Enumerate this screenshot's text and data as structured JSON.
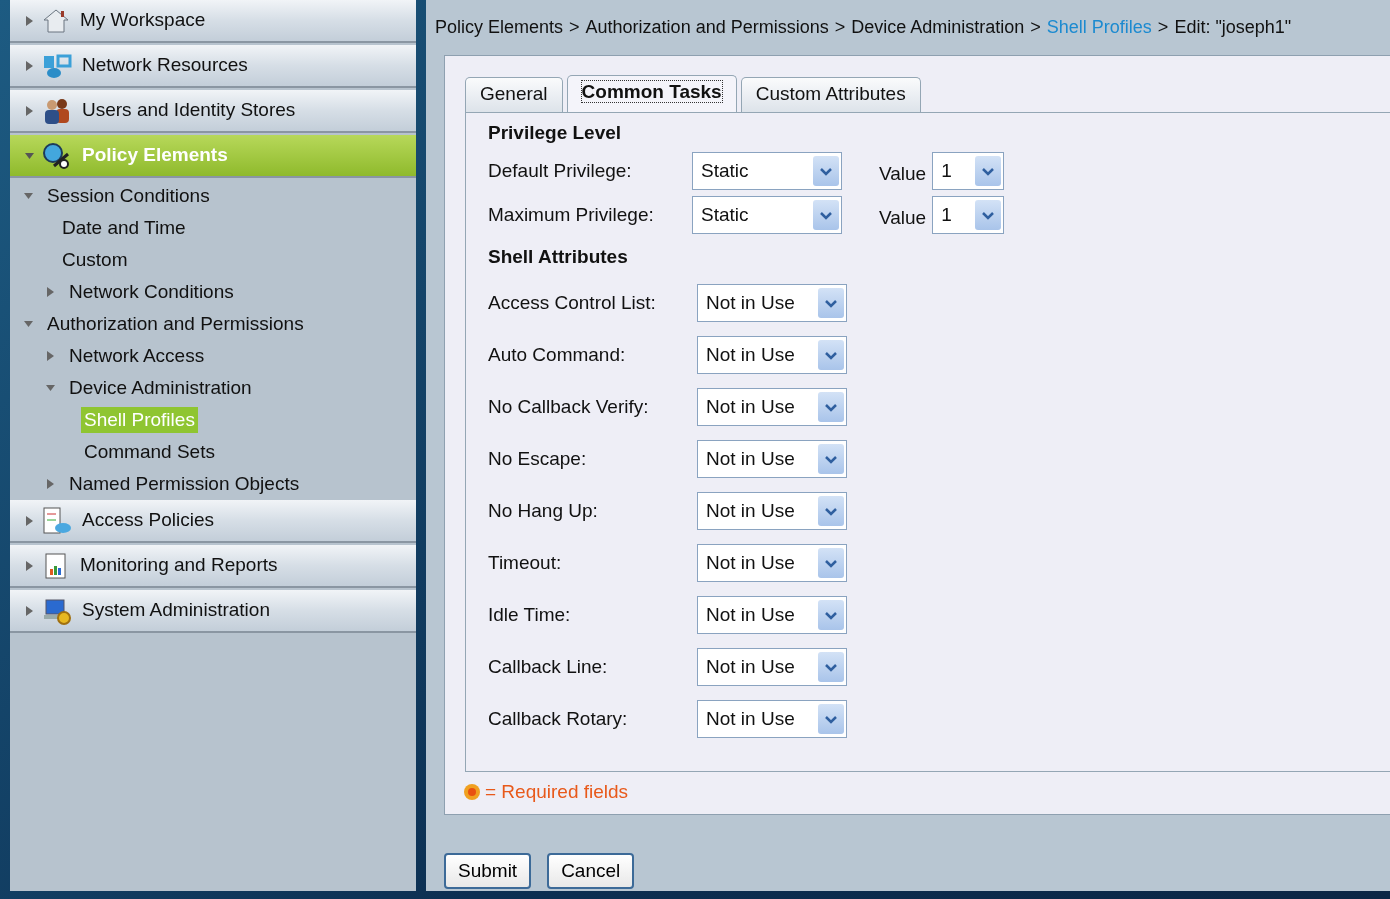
{
  "sidebar": {
    "items": [
      {
        "label": "My Workspace",
        "expanded": false,
        "selected": false
      },
      {
        "label": "Network Resources",
        "expanded": false,
        "selected": false
      },
      {
        "label": "Users and Identity Stores",
        "expanded": false,
        "selected": false
      },
      {
        "label": "Policy Elements",
        "expanded": true,
        "selected": true,
        "children": [
          {
            "label": "Session Conditions",
            "expanded": true,
            "selected": false,
            "children": [
              {
                "label": "Date and Time",
                "selected": false
              },
              {
                "label": "Custom",
                "selected": false
              },
              {
                "label": "Network Conditions",
                "expanded": false,
                "selected": false
              }
            ]
          },
          {
            "label": "Authorization and Permissions",
            "expanded": true,
            "selected": false,
            "children": [
              {
                "label": "Network Access",
                "expanded": false,
                "selected": false
              },
              {
                "label": "Device Administration",
                "expanded": true,
                "selected": false,
                "children": [
                  {
                    "label": "Shell Profiles",
                    "selected": true
                  },
                  {
                    "label": "Command Sets",
                    "selected": false
                  }
                ]
              },
              {
                "label": "Named Permission Objects",
                "expanded": false,
                "selected": false
              }
            ]
          }
        ]
      },
      {
        "label": "Access Policies",
        "expanded": false,
        "selected": false
      },
      {
        "label": "Monitoring and Reports",
        "expanded": false,
        "selected": false
      },
      {
        "label": "System Administration",
        "expanded": false,
        "selected": false
      }
    ]
  },
  "breadcrumb": [
    {
      "kind": "text",
      "text": "Policy Elements"
    },
    {
      "kind": "separator",
      "text": ">"
    },
    {
      "kind": "text",
      "text": "Authorization and Permissions"
    },
    {
      "kind": "separator",
      "text": ">"
    },
    {
      "kind": "text",
      "text": "Device Administration"
    },
    {
      "kind": "separator",
      "text": ">"
    },
    {
      "kind": "link",
      "text": "Shell Profiles"
    },
    {
      "kind": "separator",
      "text": ">"
    },
    {
      "kind": "text",
      "text": "Edit: \"joseph1\""
    }
  ],
  "tabs": [
    {
      "label": "General",
      "selected": false
    },
    {
      "label": "Common Tasks",
      "selected": true
    },
    {
      "label": "Custom Attributes",
      "selected": false
    }
  ],
  "sections": [
    {
      "title": "Privilege Level",
      "rows": [
        {
          "label": "Default Privilege:",
          "value": "Static",
          "extra": {
            "label": "Value",
            "value": "1"
          }
        },
        {
          "label": "Maximum Privilege:",
          "value": "Static",
          "extra": {
            "label": "Value",
            "value": "1"
          }
        }
      ]
    },
    {
      "title": "Shell Attributes",
      "rows": [
        {
          "label": "Access Control List:",
          "value": "Not in Use"
        },
        {
          "label": "Auto Command:",
          "value": "Not in Use"
        },
        {
          "label": "No Callback Verify:",
          "value": "Not in Use"
        },
        {
          "label": "No Escape:",
          "value": "Not in Use"
        },
        {
          "label": "No Hang Up:",
          "value": "Not in Use"
        },
        {
          "label": "Timeout:",
          "value": "Not in Use"
        },
        {
          "label": "Idle Time:",
          "value": "Not in Use"
        },
        {
          "label": "Callback Line:",
          "value": "Not in Use"
        },
        {
          "label": "Callback Rotary:",
          "value": "Not in Use"
        }
      ]
    }
  ],
  "required_note": "= Required fields",
  "buttons": [
    "Submit",
    "Cancel"
  ]
}
